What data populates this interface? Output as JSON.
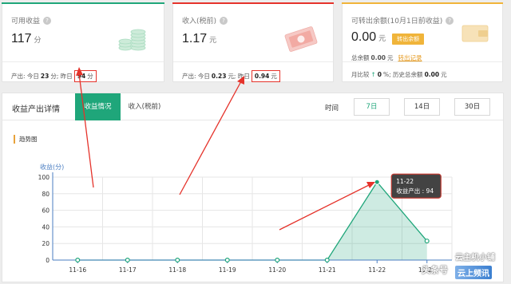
{
  "cards": [
    {
      "title": "可用收益",
      "value": "117",
      "unit": "分",
      "foot": {
        "prefix": "产出: 今日",
        "today": "23",
        "today_unit": "分; 昨日",
        "yesterday": "94",
        "yesterday_unit": "分"
      },
      "accent": "#1fa67a"
    },
    {
      "title": "收入(税前)",
      "value": "1.17",
      "unit": "元",
      "foot": {
        "prefix": "产出: 今日",
        "today": "0.23",
        "today_unit": "元; 昨日",
        "yesterday": "0.94",
        "yesterday_unit": "元"
      },
      "accent": "#e5332b"
    },
    {
      "title": "可转出余额(10月1日前收益)",
      "value": "0.00",
      "unit": "元",
      "withdraw_button": "转出余额",
      "sub": {
        "label": "总余额",
        "value": "0.00",
        "unit": "元",
        "link": "转出记录"
      },
      "foot": {
        "prefix": "月比较",
        "arrow": "↑",
        "pct": "0",
        "suffix": "%; 历史总余额",
        "value": "0.00",
        "unit": "元"
      },
      "accent": "#f0b43a"
    }
  ],
  "panel": {
    "title": "收益产出详情",
    "tabs": [
      "收益情况",
      "收入(税前)"
    ],
    "time_label": "时间",
    "ranges": [
      "7日",
      "14日",
      "30日"
    ],
    "selected_range": "7日",
    "trend_label": "趋势图"
  },
  "tooltip": {
    "date": "11-22",
    "text": "收益产出 : 94"
  },
  "watermark": {
    "line1": "头条号",
    "line2": "云主机小铺",
    "line3": "云上频讯"
  },
  "chart_data": {
    "type": "area",
    "ylabel": "收益(分)",
    "ylim": [
      0,
      100
    ],
    "yticks": [
      0,
      20,
      40,
      60,
      80,
      100
    ],
    "categories": [
      "11-16",
      "11-17",
      "11-18",
      "11-19",
      "11-20",
      "11-21",
      "11-22",
      "11-23"
    ],
    "values": [
      0,
      0,
      0,
      0,
      0,
      0,
      94,
      23
    ],
    "grid": true,
    "color": "#1fa67a"
  }
}
